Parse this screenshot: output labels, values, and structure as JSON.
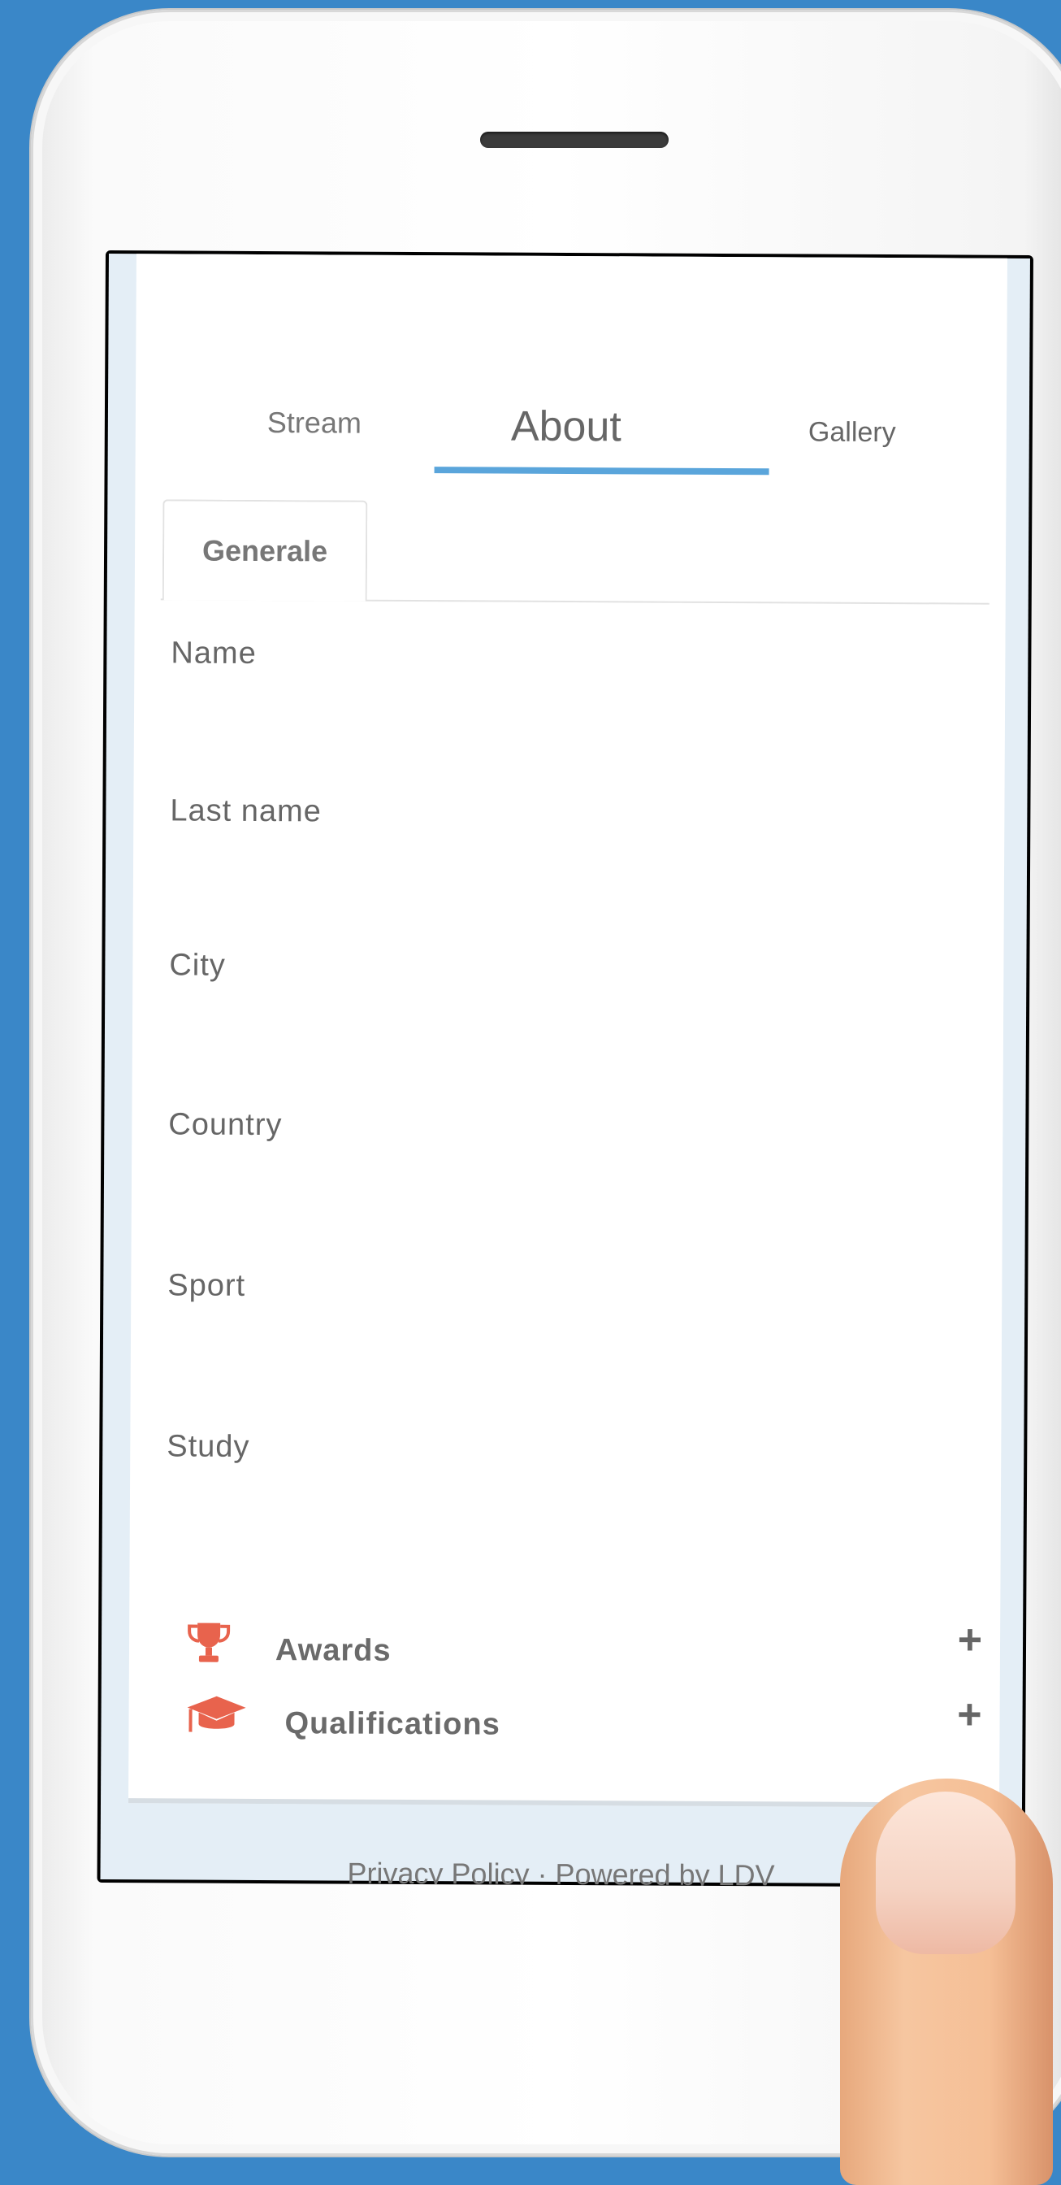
{
  "tabs": {
    "stream": "Stream",
    "about": "About",
    "gallery": "Gallery"
  },
  "subtab": "Generale",
  "fields": [
    "Name",
    "Last name",
    "City",
    "Country",
    "Sport",
    "Study"
  ],
  "sections": [
    {
      "title": "Awards",
      "icon": "trophy-icon",
      "action": "+"
    },
    {
      "title": "Qualifications",
      "icon": "graduation-cap-icon",
      "action": "+"
    }
  ],
  "footer": "Privacy Policy · Powered by LDV",
  "colors": {
    "background": "#3a87c8",
    "tab_underline": "#5aa5db",
    "icon_accent": "#e8634d"
  }
}
